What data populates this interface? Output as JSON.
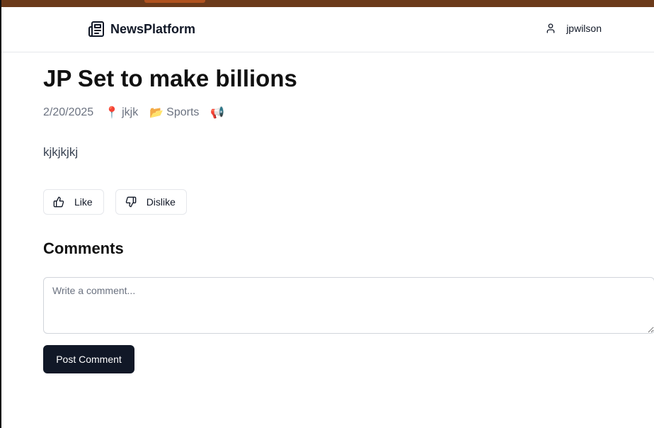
{
  "nav": {
    "brand": "NewsPlatform",
    "brand_icon": "newspaper-icon",
    "username": "jpwilson",
    "user_icon": "user-icon"
  },
  "article": {
    "title": "JP Set to make billions",
    "date": "2/20/2025",
    "location_emoji": "📍",
    "location": "jkjk",
    "category_emoji": "📂",
    "category": "Sports",
    "extra_emoji": "📢",
    "body": "kjkjkjkj"
  },
  "reactions": {
    "like_label": "Like",
    "dislike_label": "Dislike"
  },
  "comments": {
    "heading": "Comments",
    "placeholder": "Write a comment...",
    "value": "",
    "post_label": "Post Comment"
  },
  "colors": {
    "top_strip": "#6b3a1a",
    "primary_button": "#111827",
    "muted_text": "#6b7280"
  }
}
